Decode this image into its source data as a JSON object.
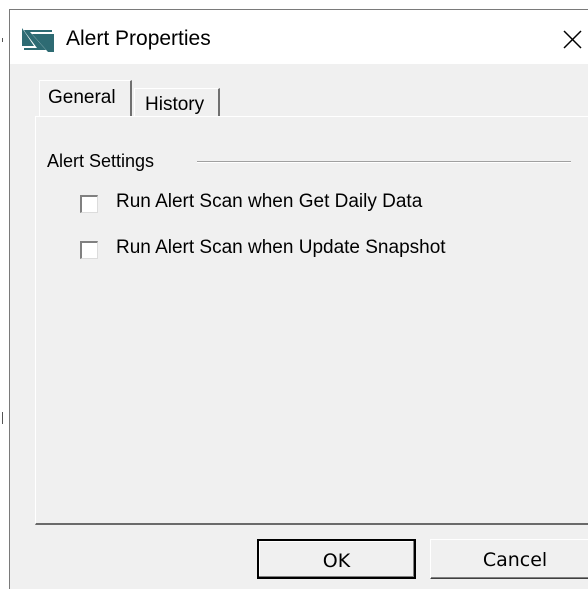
{
  "window": {
    "title": "Alert Properties",
    "icon": "app-logo-icon",
    "close_icon": "close-icon"
  },
  "tabs": [
    {
      "label": "General",
      "selected": true
    },
    {
      "label": "History",
      "selected": false
    }
  ],
  "general": {
    "group_label": "Alert Settings",
    "options": [
      {
        "label": "Run Alert Scan when Get Daily Data",
        "checked": false
      },
      {
        "label": "Run Alert Scan when Update Snapshot",
        "checked": false
      }
    ]
  },
  "buttons": {
    "ok_label": "OK",
    "cancel_label": "Cancel"
  },
  "colors": {
    "dialog_background": "#f0f0f0",
    "titlebar_background": "#ffffff",
    "icon_teal": "#2e6b73"
  }
}
